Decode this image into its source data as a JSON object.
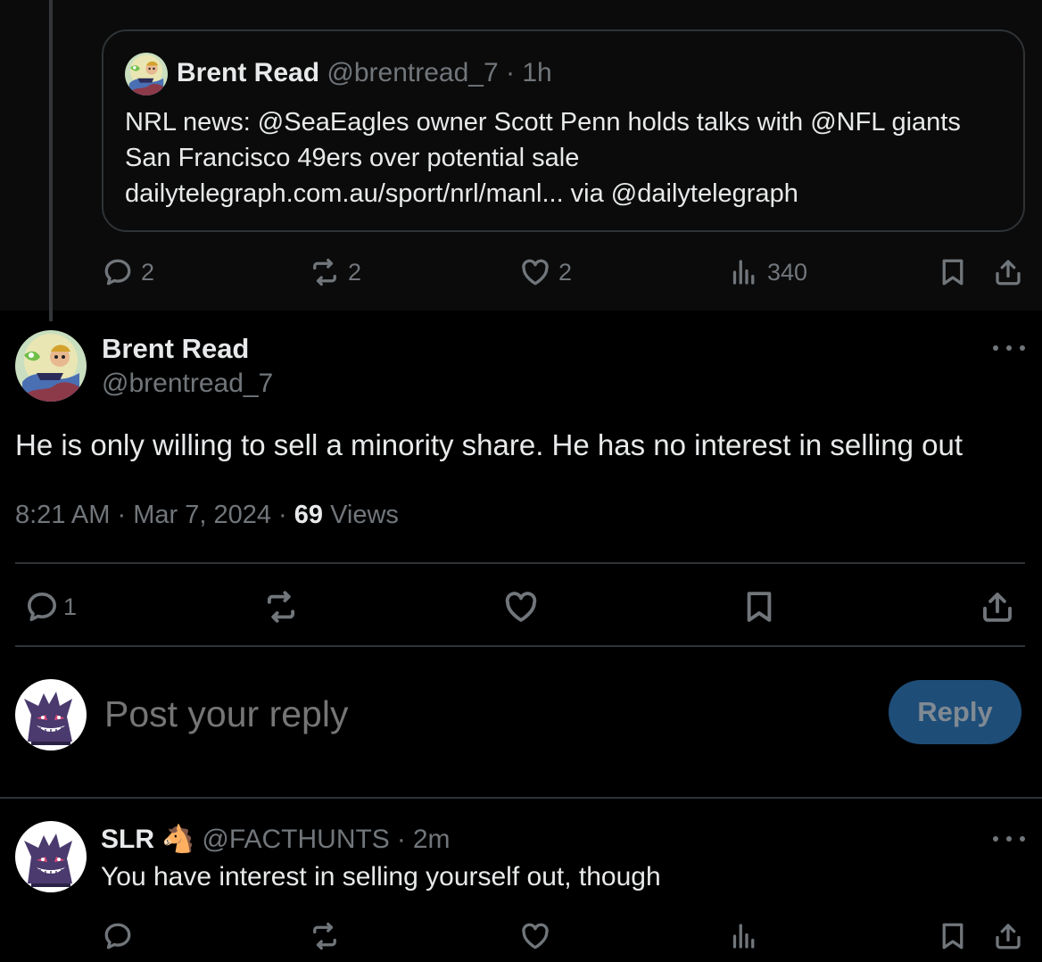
{
  "quoted_post": {
    "author_name": "Brent Read",
    "author_handle": "@brentread_7",
    "separator": "·",
    "time": "1h",
    "text": "NRL news: @SeaEagles owner Scott Penn holds talks with @NFL giants San Francisco 49ers over potential sale dailytelegraph.com.au/sport/nrl/manl... via @dailytelegraph",
    "replies": "2",
    "reposts": "2",
    "likes": "2",
    "views": "340"
  },
  "main_post": {
    "author_name": "Brent Read",
    "author_handle": "@brentread_7",
    "text": "He is only willing to sell a minority share. He has no interest in selling out",
    "time": "8:21 AM",
    "separator": "·",
    "date": "Mar 7, 2024",
    "views_count": "69",
    "views_label": "Views",
    "replies": "1"
  },
  "composer": {
    "placeholder": "Post your reply",
    "button_label": "Reply"
  },
  "reply": {
    "author_name": "SLR",
    "author_emoji": "🐴",
    "author_handle": "@FACTHUNTS",
    "separator": "·",
    "time": "2m",
    "text": "You have interest in selling yourself out, though"
  },
  "colors": {
    "background": "#000000",
    "text": "#e7e9ea",
    "muted": "#71767b",
    "border": "#2f3336",
    "reply_button": "#1e4d78"
  },
  "icons": [
    "reply-icon",
    "repost-icon",
    "like-icon",
    "views-icon",
    "bookmark-icon",
    "share-icon",
    "more-icon"
  ]
}
